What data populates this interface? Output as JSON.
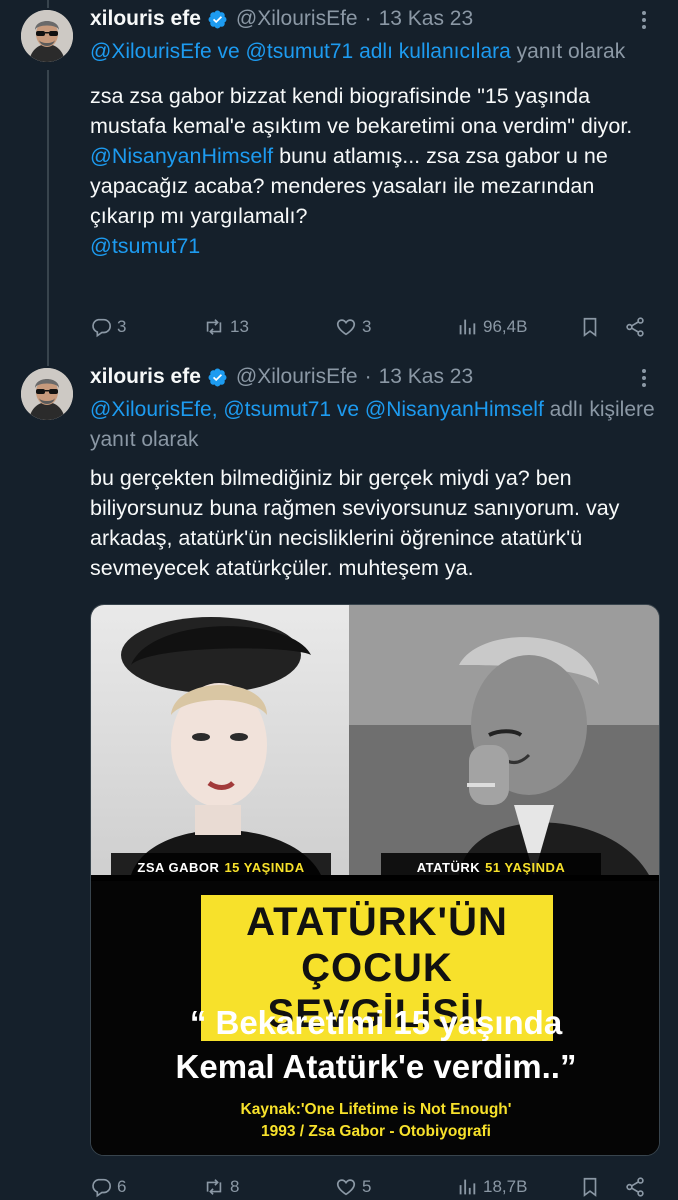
{
  "tweets": [
    {
      "author": {
        "name": "xilouris efe",
        "handle": "@XilourisEfe",
        "date": "13 Kas 23",
        "verified": true
      },
      "reply_to": {
        "mentions": "@XilourisEfe ve @tsumut71 adlı kullanıcılara",
        "suffix": "yanıt olarak"
      },
      "text": {
        "part1": "zsa zsa gabor bizzat kendi biografisinde \"15 yaşında mustafa kemal'e aşıktım ve bekaretimi ona verdim\" diyor. ",
        "mention1": "@NisanyanHimself",
        "part2": " bunu atlamış... zsa zsa gabor u ne yapacağız acaba? menderes yasaları ile mezarından çıkarıp mı yargılamalı?",
        "mention2": "@tsumut71"
      },
      "stats": {
        "replies": "3",
        "retweets": "13",
        "likes": "3",
        "views": "96,4B"
      }
    },
    {
      "author": {
        "name": "xilouris efe",
        "handle": "@XilourisEfe",
        "date": "13 Kas 23",
        "verified": true
      },
      "reply_to": {
        "mentions": "@XilourisEfe, @tsumut71 ve @NisanyanHimself",
        "suffix": "adlı kişilere yanıt olarak"
      },
      "text": {
        "full": "bu gerçekten bilmediğiniz bir gerçek miydi ya? ben biliyorsunuz buna rağmen seviyorsunuz sanıyorum. vay arkadaş, atatürk'ün necisliklerini öğrenince atatürk'ü sevmeyecek atatürkçüler. muhteşem ya."
      },
      "media": {
        "caption_left": "ZSA GABOR",
        "caption_left_age": "15 YAŞINDA",
        "caption_right": "ATATÜRK",
        "caption_right_age": "51 YAŞINDA",
        "headline_line1": "ATATÜRK'ÜN",
        "headline_line2": "ÇOCUK SEVGİLİSİ!",
        "quote_line1": "“ Bekaretimi 15 yaşında",
        "quote_line2": "Kemal Atatürk'e verdim..”",
        "source_line1": "Kaynak:'One Lifetime is Not Enough'",
        "source_line2": "1993 / Zsa Gabor - Otobiyografi"
      },
      "stats": {
        "replies": "6",
        "retweets": "8",
        "likes": "5",
        "views": "18,7B"
      }
    }
  ],
  "colors": {
    "background": "#15202b",
    "accent": "#1d9bf0",
    "muted": "#8b98a5"
  },
  "icons": [
    "verified-badge-icon",
    "more-icon",
    "reply-icon",
    "retweet-icon",
    "like-icon",
    "views-icon",
    "bookmark-icon",
    "share-icon"
  ]
}
